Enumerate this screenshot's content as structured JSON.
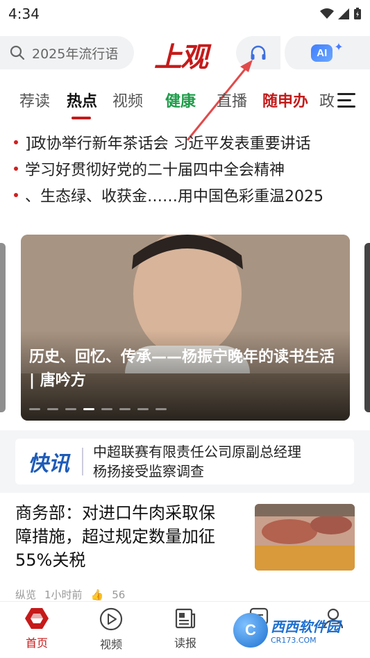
{
  "status_bar": {
    "time": "4:34"
  },
  "header": {
    "search_placeholder": "2025年流行语",
    "logo": "上观",
    "ai_label": "AI",
    "icons": {
      "search": "search-icon",
      "audio": "headphones-icon",
      "ai_sparkle": "sparkle-icon"
    }
  },
  "tabs": [
    {
      "label": "荐读"
    },
    {
      "label": "热点",
      "active": true
    },
    {
      "label": "视频"
    },
    {
      "label": "健康"
    },
    {
      "label": "直播"
    },
    {
      "label": "随申办"
    },
    {
      "label": "政"
    }
  ],
  "headlines": [
    "]政协举行新年茶话会 习近平发表重要讲话",
    "学习好贯彻好党的二十届四中全会精神",
    "、生态绿、收获金……用中国色彩重温2025"
  ],
  "carousel": {
    "caption": "历史、回忆、传承——杨振宁晚年的读书生活 | 唐吟方",
    "slide_count": 8,
    "active_index": 3
  },
  "flash": {
    "logo": "快讯",
    "text_line1": "中超联赛有限责任公司原副总经理",
    "text_line2": "杨扬接受监察调查"
  },
  "article": {
    "title_line1": "商务部：对进口牛肉采取保",
    "title_line2": "障措施，超过规定数量加征",
    "title_line3": "55%关税",
    "source": "纵览",
    "time": "1小时前",
    "likes": "56"
  },
  "bottom_nav": [
    {
      "label": "首页",
      "icon": "home-icon",
      "active": true
    },
    {
      "label": "视频",
      "icon": "play-icon"
    },
    {
      "label": "读报",
      "icon": "newspaper-icon"
    },
    {
      "label": "",
      "icon": "chat-icon"
    },
    {
      "label": "",
      "icon": "profile-icon"
    }
  ],
  "watermark": {
    "brand": "西西软件园",
    "url": "CR173.COM"
  },
  "colors": {
    "brand_red": "#c61a1a",
    "health_green": "#1f9d4a",
    "flash_blue": "#1e5bb8"
  }
}
